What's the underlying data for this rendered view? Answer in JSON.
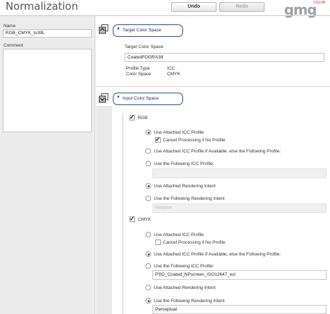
{
  "header": {
    "title": "Normalization",
    "undo_label": "Undo",
    "redo_label": "Redo",
    "logo_text": "gmg",
    "logo_sub": "COLOR"
  },
  "sidebar": {
    "name_label": "Name",
    "name_value": "RGB_CMYK_to39L",
    "comment_label": "Comment",
    "comment_value": ""
  },
  "target": {
    "section_label": "Target Color Space",
    "field_label": "Target Color Space",
    "value": "CoatedFOGRA39",
    "profile_type_label": "Profile Type",
    "profile_type_value": "ICC",
    "color_space_label": "Color Space",
    "color_space_value": "CMYK"
  },
  "input": {
    "section_label": "Input Color Space",
    "rgb": {
      "label": "RGB",
      "checked": true,
      "opt_attached": "Use Attached ICC Profile",
      "cancel_label": "Cancel Processing if No Profile",
      "opt_if_available": "Use Attached ICC Profile if Available, else the Following Profile:",
      "opt_following": "Use the Following ICC Profile:",
      "profile_value": "",
      "opt_attached_intent": "Use Attached Rendering Intent",
      "opt_following_intent": "Use the Following Rendering Intent",
      "intent_value": "Relative"
    },
    "cmyk": {
      "label": "CMYK",
      "checked": true,
      "opt_attached": "Use Attached ICC Profile",
      "cancel_label": "Cancel Processing if No Profile",
      "opt_if_available": "Use Attached ICC Profile if Available, else the Following Profile:",
      "opt_following": "Use the Following ICC Profile:",
      "profile_value": "PSO_Coated_NPscreen_ISO12647_eci",
      "opt_attached_intent": "Use Attached Rendering Intent",
      "opt_following_intent": "Use the Following Rendering Intent",
      "intent_value": "Perceptual"
    }
  },
  "colors": {
    "accent": "#1f4e96",
    "sidebar_bg": "#ececec"
  }
}
